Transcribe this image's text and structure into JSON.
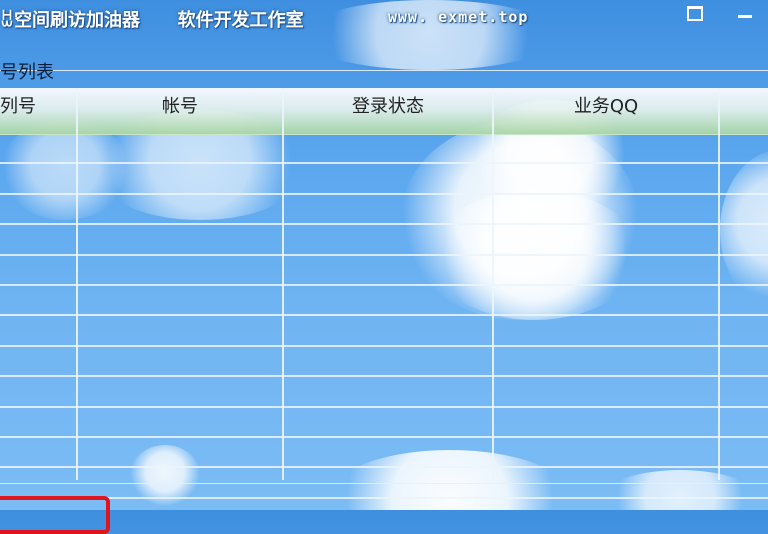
{
  "window": {
    "title": "ꀠ空间刷访加油器",
    "subtitle": "软件开发工作室",
    "url": "www. exmet.top"
  },
  "group": {
    "title": "号列表"
  },
  "table": {
    "columns": [
      "列号",
      "帐号",
      "登录状态",
      "业务QQ",
      ""
    ],
    "rows": [
      [
        "",
        "",
        "",
        "",
        ""
      ],
      [
        "",
        "",
        "",
        "",
        ""
      ],
      [
        "",
        "",
        "",
        "",
        ""
      ],
      [
        "",
        "",
        "",
        "",
        ""
      ],
      [
        "",
        "",
        "",
        "",
        ""
      ],
      [
        "",
        "",
        "",
        "",
        ""
      ],
      [
        "",
        "",
        "",
        "",
        ""
      ],
      [
        "",
        "",
        "",
        "",
        ""
      ],
      [
        "",
        "",
        "",
        "",
        ""
      ],
      [
        "",
        "",
        "",
        "",
        ""
      ],
      [
        "",
        "",
        "",
        "",
        ""
      ],
      [
        "",
        "",
        "",
        "",
        ""
      ]
    ]
  },
  "icons": {
    "restore": "restore-icon",
    "minimize": "minimize-icon"
  },
  "colors": {
    "sky": "#5aa6ee",
    "header_green": "#a8d6a5",
    "highlight_red": "#e0141e"
  }
}
